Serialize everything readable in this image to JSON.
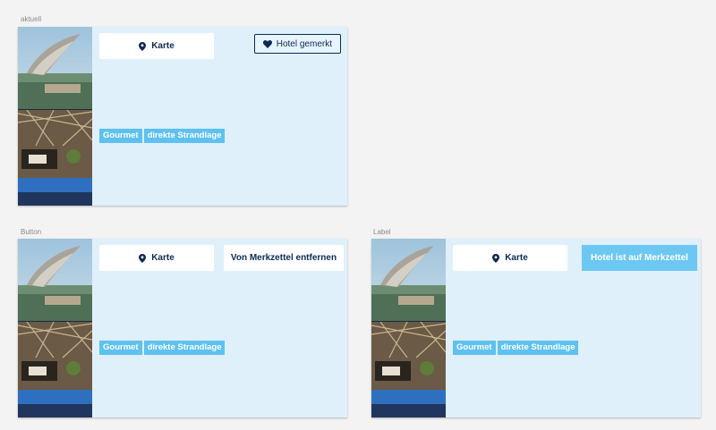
{
  "variants": [
    {
      "caption": "aktuell",
      "map_button": "Karte",
      "tags": [
        "Gourmet",
        "direkte Strandlage"
      ],
      "action": {
        "kind": "bookmark-button",
        "label": "Hotel gemerkt",
        "icon": "heart-icon"
      }
    },
    {
      "caption": "Button",
      "map_button": "Karte",
      "tags": [
        "Gourmet",
        "direkte Strandlage"
      ],
      "action": {
        "kind": "remove-button",
        "label": "Von Merkzettel entfernen"
      }
    },
    {
      "caption": "Label",
      "map_button": "Karte",
      "tags": [
        "Gourmet",
        "direkte Strandlage"
      ],
      "action": {
        "kind": "status-label",
        "label": "Hotel ist auf Merkzettel"
      }
    }
  ],
  "icons": {
    "map": "map-pin-icon",
    "bookmark": "heart-icon"
  },
  "colors": {
    "card_background": "#dff0fb",
    "navy": "#0d2a55",
    "tag": "#5ec1ef",
    "label": "#6cc8f2"
  }
}
